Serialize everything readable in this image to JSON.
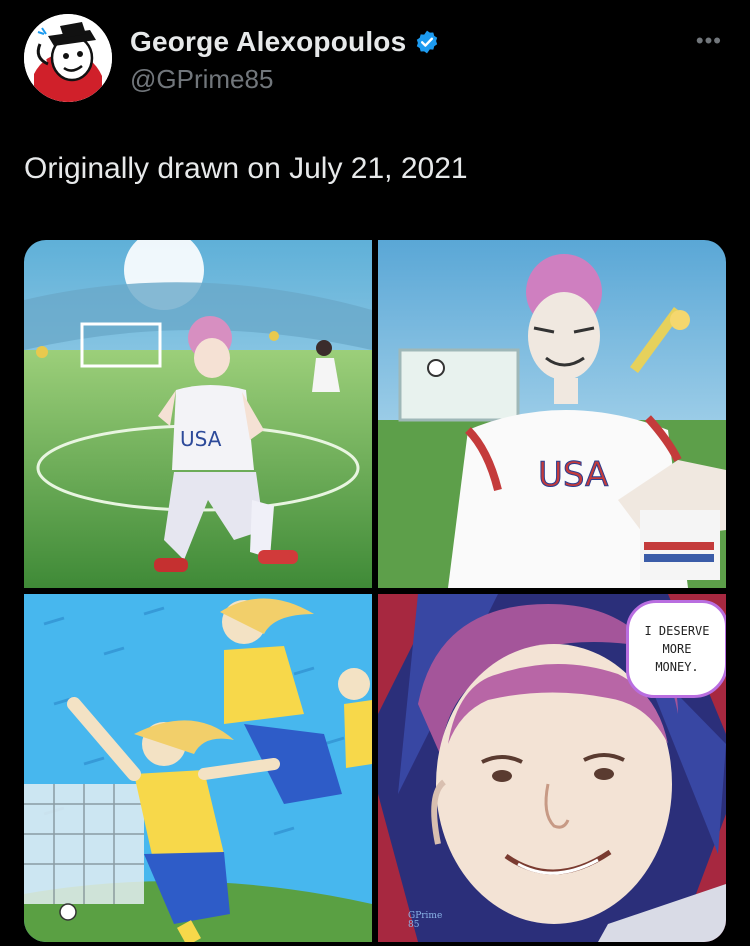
{
  "author": {
    "display_name": "George Alexopoulos",
    "handle": "@GPrime85",
    "verified_icon": "verified-badge-icon",
    "verified_color": "#1d9bf0"
  },
  "more_icon": "ellipsis-icon",
  "more_label": "•••",
  "tweet": {
    "text": "Originally drawn on July 21, 2021"
  },
  "comic": {
    "panel_count": 4,
    "jersey_text": "USA",
    "speech_bubble": [
      "I DESERVE",
      "MORE",
      "MONEY."
    ],
    "signature": [
      "GPrime",
      "85"
    ]
  },
  "colors": {
    "background": "#000000",
    "text_primary": "#e7e9ea",
    "text_secondary": "#71767b"
  }
}
